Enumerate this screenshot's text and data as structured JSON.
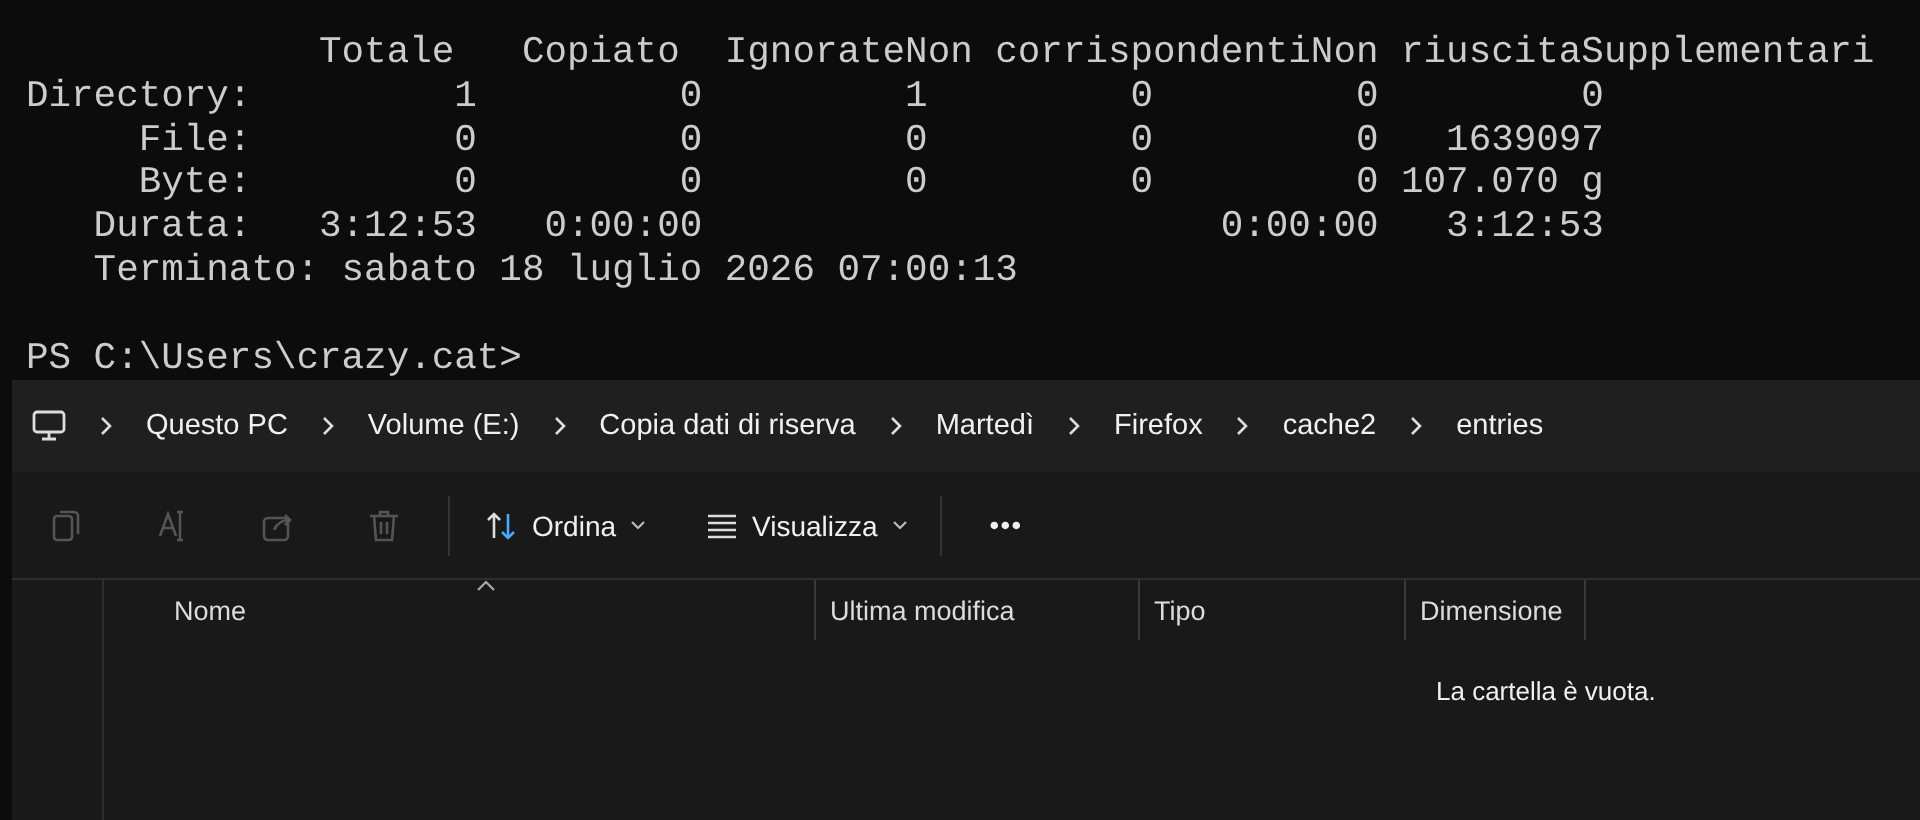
{
  "terminal": {
    "lines": [
      "             Totale   Copiato  IgnorateNon corrispondentiNon riuscitaSupplementari",
      "Directory:         1         0         1         0         0         0",
      "     File:         0         0         0         0         0   1639097",
      "     Byte:         0         0         0         0         0 107.070 g",
      "   Durata:   3:12:53   0:00:00                       0:00:00   3:12:53",
      "   Terminato: sabato 18 luglio 2026 07:00:13"
    ],
    "prompt": "PS C:\\Users\\crazy.cat>"
  },
  "explorer": {
    "breadcrumbs": [
      "Questo PC",
      "Volume (E:)",
      "Copia dati di riserva",
      "Martedì",
      "Firefox",
      "cache2",
      "entries"
    ],
    "toolbar": [
      {
        "kind": "copy",
        "disabled": true
      },
      {
        "kind": "rename",
        "disabled": true
      },
      {
        "kind": "share",
        "disabled": true
      },
      {
        "kind": "delete",
        "disabled": true
      },
      {
        "kind": "separator"
      },
      {
        "kind": "sort",
        "label": "Ordina"
      },
      {
        "kind": "view",
        "label": "Visualizza"
      },
      {
        "kind": "separator"
      },
      {
        "kind": "more",
        "label": "•••"
      }
    ],
    "columns": [
      {
        "label": "Nome",
        "sorted": true
      },
      {
        "label": "Ultima modifica",
        "sorted": false
      },
      {
        "label": "Tipo",
        "sorted": false
      },
      {
        "label": "Dimensione",
        "sorted": false
      }
    ],
    "empty_message": "La cartella è vuota."
  }
}
